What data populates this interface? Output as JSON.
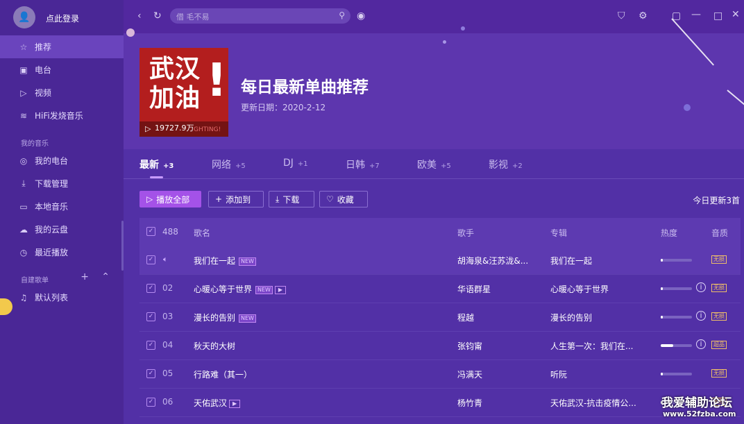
{
  "sidebar": {
    "login": "点此登录",
    "items": [
      {
        "label": "推荐",
        "icon": "star-icon"
      },
      {
        "label": "电台",
        "icon": "radio-icon"
      },
      {
        "label": "视频",
        "icon": "video-icon"
      },
      {
        "label": "HiFi发烧音乐",
        "icon": "waveform-icon"
      }
    ],
    "my_music_label": "我的音乐",
    "my_items": [
      {
        "label": "我的电台",
        "icon": "radio-circle-icon"
      },
      {
        "label": "下载管理",
        "icon": "download-icon"
      },
      {
        "label": "本地音乐",
        "icon": "monitor-icon"
      },
      {
        "label": "我的云盘",
        "icon": "cloud-icon"
      },
      {
        "label": "最近播放",
        "icon": "clock-icon"
      }
    ],
    "playlists_label": "自建歌单",
    "playlists": [
      {
        "label": "默认列表",
        "icon": "playlist-icon"
      }
    ]
  },
  "search": {
    "placeholder": "借 毛不易"
  },
  "hero": {
    "cover_text_line1": "武汉",
    "cover_text_line2": "加油",
    "cover_watermark": "GHTING!",
    "play_count": "19727.9万",
    "title": "每日最新单曲推荐",
    "update_date": "更新日期：2020-2-12"
  },
  "tabs": [
    {
      "label": "最新",
      "count": "+3"
    },
    {
      "label": "网络",
      "count": "+5"
    },
    {
      "label": "DJ",
      "count": "+1"
    },
    {
      "label": "日韩",
      "count": "+7"
    },
    {
      "label": "欧美",
      "count": "+5"
    },
    {
      "label": "影视",
      "count": "+2"
    }
  ],
  "actions": {
    "play_all": "播放全部",
    "add_to": "添加到",
    "download": "下载",
    "favorite": "收藏",
    "today_update": "今日更新3首"
  },
  "table": {
    "total": "488",
    "headers": {
      "song": "歌名",
      "artist": "歌手",
      "album": "专辑",
      "heat": "热度",
      "quality": "音质"
    },
    "rows": [
      {
        "index": "",
        "title": "我们在一起",
        "new": true,
        "mv": false,
        "artist": "胡海泉&汪苏泷&...",
        "album": "我们在一起",
        "heat": 0.06,
        "info": false,
        "quality": "无损"
      },
      {
        "index": "02",
        "title": "心暖心等于世界",
        "new": true,
        "mv": true,
        "artist": "华语群星",
        "album": "心暖心等于世界",
        "heat": 0.06,
        "info": true,
        "quality": "无损"
      },
      {
        "index": "03",
        "title": "漫长的告别",
        "new": true,
        "mv": false,
        "artist": "程越",
        "album": "漫长的告别",
        "heat": 0.06,
        "info": true,
        "quality": "无损"
      },
      {
        "index": "04",
        "title": "秋天的大树",
        "new": false,
        "mv": false,
        "artist": "张钧甯",
        "album": "人生第一次：我们在...",
        "heat": 0.4,
        "info": true,
        "quality": "超品"
      },
      {
        "index": "05",
        "title": "行路难（其一）",
        "new": false,
        "mv": false,
        "artist": "冯满天",
        "album": "听阮",
        "heat": 0.06,
        "info": false,
        "quality": "无损"
      },
      {
        "index": "06",
        "title": "天佑武汉",
        "new": false,
        "mv": true,
        "artist": "杨竹青",
        "album": "天佑武汉-抗击疫情公...",
        "heat": 0.06,
        "info": false,
        "quality": "无损"
      }
    ],
    "new_badge": "NEW"
  },
  "watermark": {
    "line1": "我爱辅助论坛",
    "line2": "www.52fzba.com"
  },
  "colors": {
    "accent": "#a452e8",
    "background": "#4e2a9c",
    "quality": "#f1c067"
  }
}
